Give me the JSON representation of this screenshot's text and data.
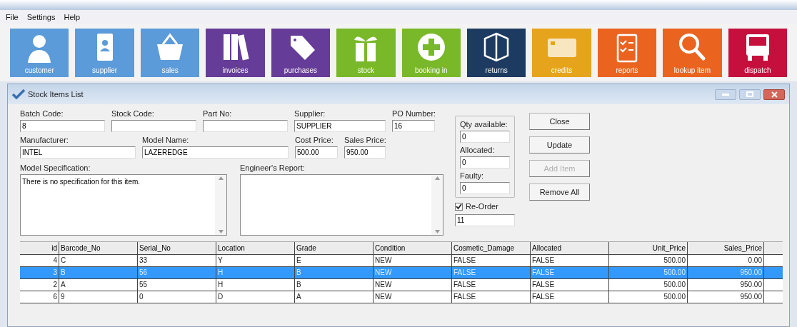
{
  "menu": [
    {
      "label": "File"
    },
    {
      "label": "Settings"
    },
    {
      "label": "Help"
    }
  ],
  "tiles": [
    {
      "label": "customer",
      "color": "#5b9bd9"
    },
    {
      "label": "supplier",
      "color": "#5b9bd9"
    },
    {
      "label": "sales",
      "color": "#5b9bd9"
    },
    {
      "label": "invoices",
      "color": "#663c99"
    },
    {
      "label": "purchases",
      "color": "#663c99"
    },
    {
      "label": "stock",
      "color": "#79b829"
    },
    {
      "label": "booking in",
      "color": "#79b829"
    },
    {
      "label": "returns",
      "color": "#1d3b61"
    },
    {
      "label": "credits",
      "color": "#e6a41c"
    },
    {
      "label": "reports",
      "color": "#ea6420"
    },
    {
      "label": "lookup item",
      "color": "#ea6420"
    },
    {
      "label": "dispatch",
      "color": "#c5103d"
    }
  ],
  "window": {
    "title": "Stock Items List"
  },
  "form": {
    "row1": [
      {
        "label": "Batch Code:",
        "value": "8"
      },
      {
        "label": "Stock Code:"
      },
      {
        "label": "Part No:"
      },
      {
        "label": "Supplier:",
        "value": "SUPPLIER"
      },
      {
        "label": "PO Number:",
        "value": "16"
      }
    ],
    "row2": [
      {
        "label": "Manufacturer:",
        "value": "INTEL"
      },
      {
        "label": "Model Name:",
        "value": "LAZEREDGE"
      },
      {
        "label": "Cost Price:",
        "value": "500.00"
      },
      {
        "label": "Sales Price:",
        "value": "950.00"
      }
    ],
    "model_specification": {
      "label": "Model Specification:",
      "value": "There is no specification for this item."
    },
    "engineers_report": {
      "label": "Engineer's Report:"
    },
    "qty": [
      {
        "label": "Qty available:",
        "value": "0"
      },
      {
        "label": "Allocated:",
        "value": "0"
      },
      {
        "label": "Faulty:",
        "value": "0"
      }
    ],
    "reorder": {
      "label": "Re-Order",
      "checked": true,
      "value": "11"
    }
  },
  "buttons": [
    {
      "label": "Close",
      "disabled": false
    },
    {
      "label": "Update",
      "disabled": false
    },
    {
      "label": "Add Item",
      "disabled": true
    },
    {
      "label": "Remove All",
      "disabled": false
    }
  ],
  "table": {
    "columns": [
      "id",
      "Barcode_No",
      "Serial_No",
      "Location",
      "Grade",
      "Condition",
      "Cosmetic_Damage",
      "Allocated",
      "Unit_Price",
      "Sales_Price"
    ],
    "rows": [
      {
        "cells": [
          "4",
          "C",
          "33",
          "Y",
          "E",
          "NEW",
          "FALSE",
          "FALSE",
          "500.00",
          "0.00"
        ],
        "selected": false
      },
      {
        "cells": [
          "3",
          "B",
          "56",
          "H",
          "B",
          "NEW",
          "FALSE",
          "FALSE",
          "500.00",
          "950.00"
        ],
        "selected": true
      },
      {
        "cells": [
          "2",
          "A",
          "55",
          "H",
          "B",
          "NEW",
          "FALSE",
          "FALSE",
          "500.00",
          "950.00"
        ],
        "selected": false
      },
      {
        "cells": [
          "6",
          "9",
          "0",
          "D",
          "A",
          "NEW",
          "FALSE",
          "FALSE",
          "500.00",
          "950.00"
        ],
        "selected": false
      }
    ]
  }
}
